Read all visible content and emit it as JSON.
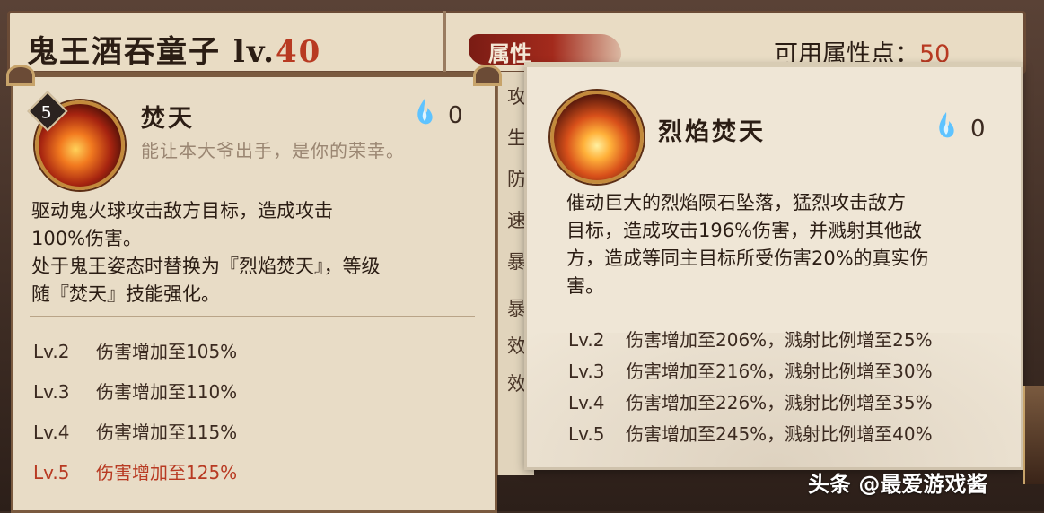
{
  "header": {
    "hero_name": "鬼王酒吞童子",
    "level_prefix": " lv.",
    "level": "40",
    "attr_tab_label": "属性",
    "points_label": "可用属性点：",
    "points_value": "50"
  },
  "left_skill": {
    "icon": "fire-fist-skill-icon",
    "level_badge": "5",
    "name": "焚天",
    "quote": "能让本大爷出手，是你的荣幸。",
    "cost_icon": "blue-flame-icon",
    "cost": "0",
    "description": [
      "驱动鬼火球攻击敌方目标，造成攻击",
      "100%伤害。",
      "处于鬼王姿态时替换为『烈焰焚天』，等级",
      "随『焚天』技能强化。"
    ],
    "levels": [
      {
        "lv": "Lv.2",
        "text": "伤害增加至105%"
      },
      {
        "lv": "Lv.3",
        "text": "伤害增加至110%"
      },
      {
        "lv": "Lv.4",
        "text": "伤害增加至115%"
      },
      {
        "lv": "Lv.5",
        "text": "伤害增加至125%"
      }
    ]
  },
  "attribute_column": [
    "攻",
    "生",
    "防",
    "速",
    "暴",
    "暴",
    "效",
    "效"
  ],
  "right_skill": {
    "icon": "meteor-fire-skill-icon",
    "name": "烈焰焚天",
    "cost_icon": "blue-flame-icon",
    "cost": "0",
    "description": [
      "催动巨大的烈焰陨石坠落，猛烈攻击敌方",
      "目标，造成攻击196%伤害，并溅射其他敌",
      "方，造成等同主目标所受伤害20%的真实伤",
      "害。"
    ],
    "levels": [
      {
        "lv": "Lv.2",
        "text": "伤害增加至206%，溅射比例增至25%"
      },
      {
        "lv": "Lv.3",
        "text": "伤害增加至216%，溅射比例增至30%"
      },
      {
        "lv": "Lv.4",
        "text": "伤害增加至226%，溅射比例增至35%"
      },
      {
        "lv": "Lv.5",
        "text": "伤害增加至245%，溅射比例增至40%"
      }
    ]
  },
  "credit": "头条 @最爱游戏酱",
  "colors": {
    "accent_red": "#b83a22",
    "panel_bg": "#e8dcc6",
    "text_dark": "#2b1d14"
  }
}
